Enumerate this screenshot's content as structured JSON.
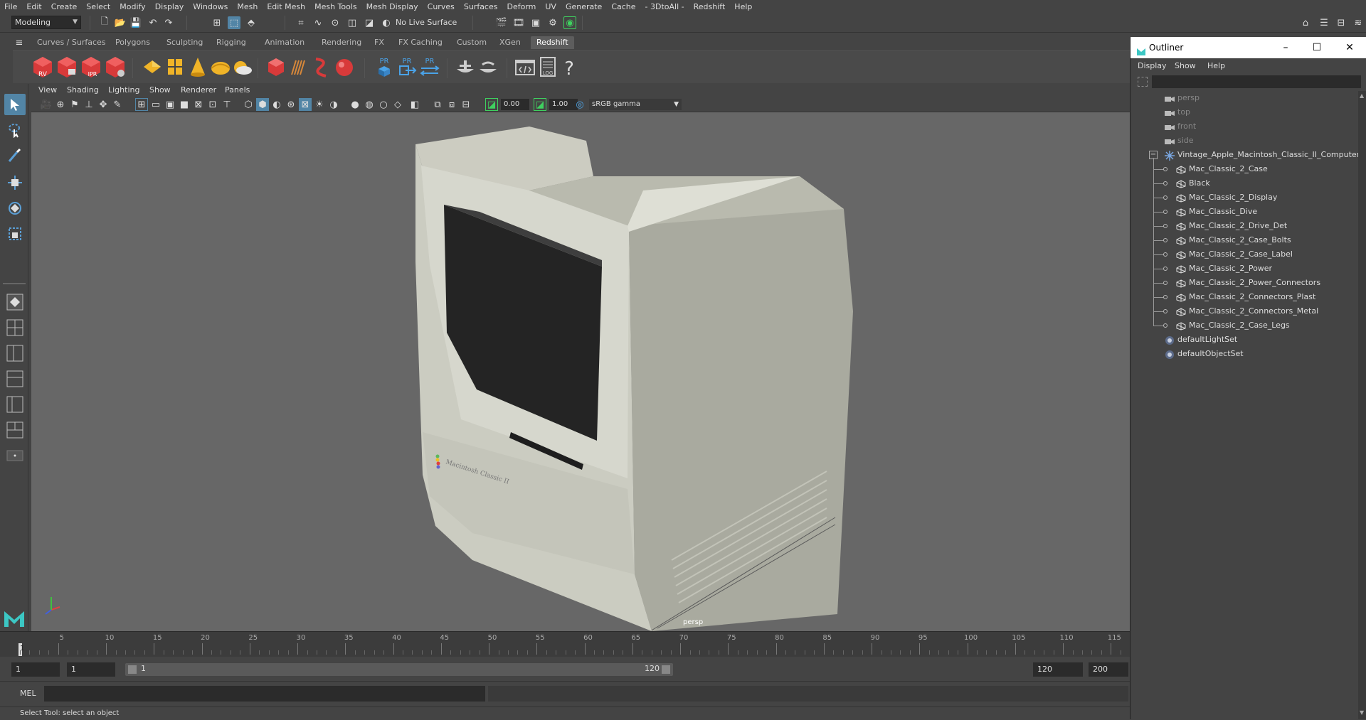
{
  "menubar": [
    "File",
    "Edit",
    "Create",
    "Select",
    "Modify",
    "Display",
    "Windows",
    "Mesh",
    "Edit Mesh",
    "Mesh Tools",
    "Mesh Display",
    "Curves",
    "Surfaces",
    "Deform",
    "UV",
    "Generate",
    "Cache",
    "- 3DtoAll -",
    "Redshift",
    "Help"
  ],
  "statusline": {
    "mode": "Modeling",
    "live_surface": "No Live Surface"
  },
  "shelf_tabs": [
    "Curves / Surfaces",
    "Polygons",
    "Sculpting",
    "Rigging",
    "Animation",
    "Rendering",
    "FX",
    "FX Caching",
    "Custom",
    "XGen",
    "Redshift"
  ],
  "shelf_active_tab": "Redshift",
  "shelf_labels": {
    "rv": "RV",
    "ipr": "IPR",
    "pr1": "PR",
    "pr2": "PR",
    "pr3": "PR",
    "log": "LOG",
    "help": "?"
  },
  "viewport": {
    "menu": [
      "View",
      "Shading",
      "Lighting",
      "Show",
      "Renderer",
      "Panels"
    ],
    "exposure": "0.00",
    "gamma": "1.00",
    "color_space": "sRGB gamma",
    "camera_label": "persp",
    "logo_text": "Macintosh Classic II"
  },
  "timeline": {
    "ticks": [
      "5",
      "10",
      "15",
      "20",
      "25",
      "30",
      "35",
      "40",
      "45",
      "50",
      "55",
      "60",
      "65",
      "70",
      "75",
      "80",
      "85",
      "90",
      "95",
      "100",
      "105",
      "110",
      "115"
    ],
    "current": "1"
  },
  "range": {
    "start_field": "1",
    "start_inner": "1",
    "range_start": "1",
    "range_end": "120",
    "end_field": "120",
    "end_total": "200"
  },
  "cmdline": {
    "label": "MEL"
  },
  "statusbar": {
    "text": "Select Tool: select an object"
  },
  "outliner": {
    "title": "Outliner",
    "window_buttons": {
      "minimize": "–",
      "maximize": "☐",
      "close": "✕"
    },
    "menu": [
      "Display",
      "Show",
      "Help"
    ],
    "cameras": [
      "persp",
      "top",
      "front",
      "side"
    ],
    "root": "Vintage_Apple_Macintosh_Classic_II_Computer_r",
    "children": [
      "Mac_Classic_2_Case",
      "Black",
      "Mac_Classic_2_Display",
      "Mac_Classic_Dive",
      "Mac_Classic_2_Drive_Det",
      "Mac_Classic_2_Case_Bolts",
      "Mac_Classic_2_Case_Label",
      "Mac_Classic_2_Power",
      "Mac_Classic_2_Power_Connectors",
      "Mac_Classic_2_Connectors_Plast",
      "Mac_Classic_2_Connectors_Metal",
      "Mac_Classic_2_Case_Legs"
    ],
    "sets": [
      "defaultLightSet",
      "defaultObjectSet"
    ]
  },
  "colors": {
    "accent": "#5285a6",
    "redshift_red": "#d83a3a",
    "shelf_yellow": "#f0b428",
    "viewport_bg": "#676767"
  }
}
